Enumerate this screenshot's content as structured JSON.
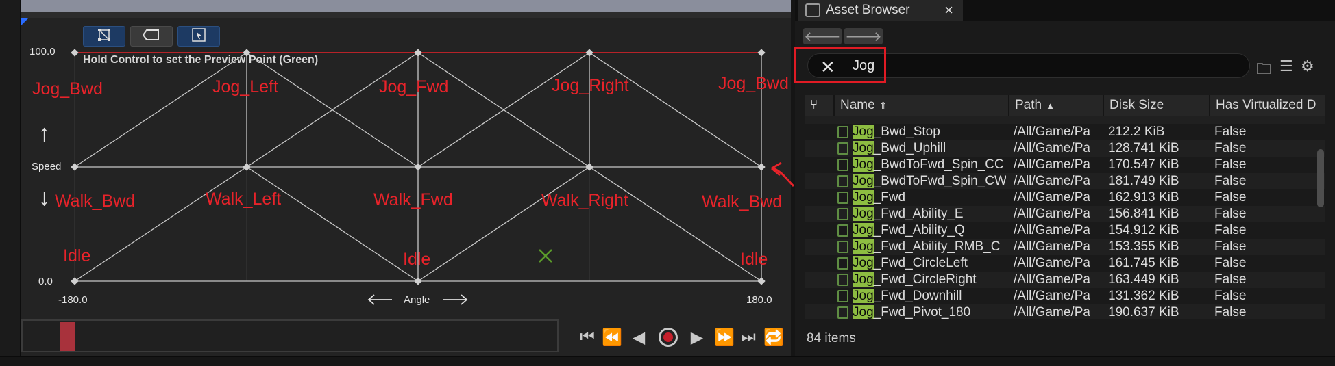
{
  "blendspace": {
    "toolbar_buttons": [
      {
        "icon": "grid-select-icon"
      },
      {
        "icon": "tag-shape-icon"
      },
      {
        "icon": "cursor-select-icon"
      }
    ],
    "hint": "Hold Control to set the Preview Point (Green)",
    "y_axis": {
      "max": "100.0",
      "min": "0.0",
      "label": "Speed"
    },
    "x_axis": {
      "min": "-180.0",
      "max": "180.0",
      "label": "Angle"
    },
    "annotations": {
      "jog_bwd_left": "Jog_Bwd",
      "jog_left": "Jog_Left",
      "jog_fwd": "Jog_Fwd",
      "jog_right": "Jog_Right",
      "jog_bwd_right": "Jog_Bwd",
      "walk_bwd_left": "Walk_Bwd",
      "walk_left": "Walk_Left",
      "walk_fwd": "Walk_Fwd",
      "walk_right": "Walk_Right",
      "walk_bwd_right": "Walk_Bwd",
      "idle_left": "Idle",
      "idle_center": "Idle",
      "idle_right": "Idle"
    },
    "annotation_color": "#e8232a",
    "preview_point_color": "#5a9a2a",
    "transport": [
      "skip-to-start-icon",
      "step-back-icon",
      "play-reverse-icon",
      "record-icon",
      "play-icon",
      "step-forward-icon",
      "skip-to-end-icon",
      "loop-icon"
    ]
  },
  "asset_browser": {
    "title": "Asset Browser",
    "search_value": "Jog",
    "highlight_color": "#8dbd41",
    "columns": {
      "name": "Name",
      "path": "Path",
      "disk_size": "Disk Size",
      "virtualized": "Has Virtualized D"
    },
    "rows": [
      {
        "prefix": "Jog",
        "rest": "_Bwd_Stop",
        "path": "/All/Game/Pa",
        "size": "212.2 KiB",
        "virt": "False"
      },
      {
        "prefix": "Jog",
        "rest": "_Bwd_Uphill",
        "path": "/All/Game/Pa",
        "size": "128.741 KiB",
        "virt": "False"
      },
      {
        "prefix": "Jog",
        "rest": "_BwdToFwd_Spin_CC",
        "path": "/All/Game/Pa",
        "size": "170.547 KiB",
        "virt": "False"
      },
      {
        "prefix": "Jog",
        "rest": "_BwdToFwd_Spin_CW",
        "path": "/All/Game/Pa",
        "size": "181.749 KiB",
        "virt": "False"
      },
      {
        "prefix": "Jog",
        "rest": "_Fwd",
        "path": "/All/Game/Pa",
        "size": "162.913 KiB",
        "virt": "False"
      },
      {
        "prefix": "Jog",
        "rest": "_Fwd_Ability_E",
        "path": "/All/Game/Pa",
        "size": "156.841 KiB",
        "virt": "False"
      },
      {
        "prefix": "Jog",
        "rest": "_Fwd_Ability_Q",
        "path": "/All/Game/Pa",
        "size": "154.912 KiB",
        "virt": "False"
      },
      {
        "prefix": "Jog",
        "rest": "_Fwd_Ability_RMB_C",
        "path": "/All/Game/Pa",
        "size": "153.355 KiB",
        "virt": "False"
      },
      {
        "prefix": "Jog",
        "rest": "_Fwd_CircleLeft",
        "path": "/All/Game/Pa",
        "size": "161.745 KiB",
        "virt": "False"
      },
      {
        "prefix": "Jog",
        "rest": "_Fwd_CircleRight",
        "path": "/All/Game/Pa",
        "size": "163.449 KiB",
        "virt": "False"
      },
      {
        "prefix": "Jog",
        "rest": "_Fwd_Downhill",
        "path": "/All/Game/Pa",
        "size": "131.362 KiB",
        "virt": "False"
      },
      {
        "prefix": "Jog",
        "rest": "_Fwd_Pivot_180",
        "path": "/All/Game/Pa",
        "size": "190.637 KiB",
        "virt": "False"
      }
    ],
    "item_count": "84 items"
  }
}
